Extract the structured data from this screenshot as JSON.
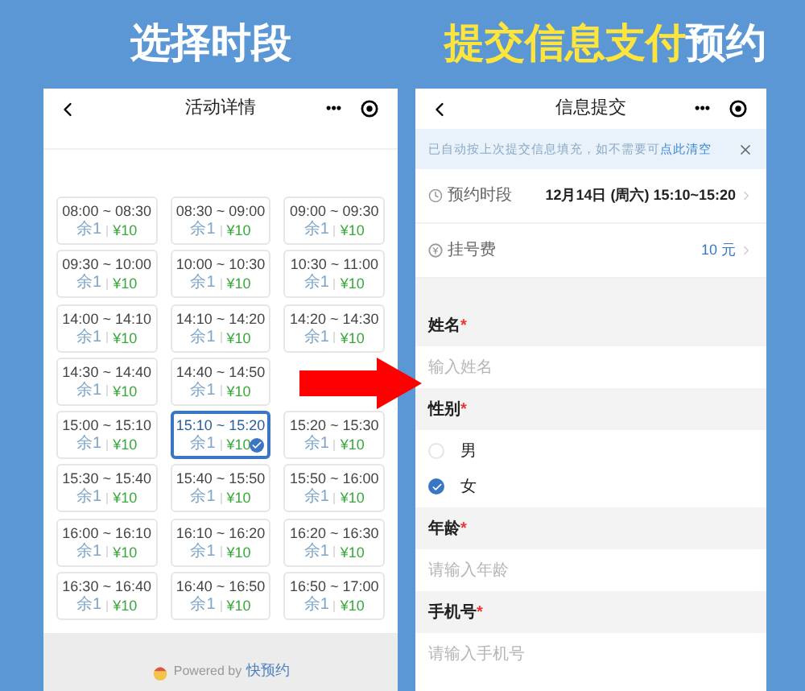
{
  "left_heading": "选择时段",
  "right_heading": {
    "highlighted": "提交信息支付",
    "plain": "预约"
  },
  "left_screen": {
    "title": "活动详情",
    "capsule_dots": "•••",
    "slots": [
      {
        "kind": "slot",
        "time": "08:00 ~ 08:30",
        "remaining": "余1",
        "price": "¥10",
        "selected": false
      },
      {
        "kind": "slot",
        "time": "08:30 ~ 09:00",
        "remaining": "余1",
        "price": "¥10",
        "selected": false
      },
      {
        "kind": "slot",
        "time": "09:00 ~ 09:30",
        "remaining": "余1",
        "price": "¥10",
        "selected": false
      },
      {
        "kind": "slot",
        "time": "09:30 ~ 10:00",
        "remaining": "余1",
        "price": "¥10",
        "selected": false
      },
      {
        "kind": "slot",
        "time": "10:00 ~ 10:30",
        "remaining": "余1",
        "price": "¥10",
        "selected": false
      },
      {
        "kind": "slot",
        "time": "10:30 ~ 11:00",
        "remaining": "余1",
        "price": "¥10",
        "selected": false
      },
      {
        "kind": "slot",
        "time": "14:00 ~ 14:10",
        "remaining": "余1",
        "price": "¥10",
        "selected": false
      },
      {
        "kind": "slot",
        "time": "14:10 ~ 14:20",
        "remaining": "余1",
        "price": "¥10",
        "selected": false
      },
      {
        "kind": "slot",
        "time": "14:20 ~ 14:30",
        "remaining": "余1",
        "price": "¥10",
        "selected": false
      },
      {
        "kind": "slot",
        "time": "14:30 ~ 14:40",
        "remaining": "余1",
        "price": "¥10",
        "selected": false
      },
      {
        "kind": "slot",
        "time": "14:40 ~ 14:50",
        "remaining": "余1",
        "price": "¥10",
        "selected": false
      },
      {
        "kind": "covered"
      },
      {
        "kind": "slot",
        "time": "15:00 ~ 15:10",
        "remaining": "余1",
        "price": "¥10",
        "selected": false
      },
      {
        "kind": "slot",
        "time": "15:10 ~ 15:20",
        "remaining": "余1",
        "price": "¥10",
        "selected": true
      },
      {
        "kind": "slot",
        "time": "15:20 ~ 15:30",
        "remaining": "余1",
        "price": "¥10",
        "selected": false
      },
      {
        "kind": "slot",
        "time": "15:30 ~ 15:40",
        "remaining": "余1",
        "price": "¥10",
        "selected": false
      },
      {
        "kind": "slot",
        "time": "15:40 ~ 15:50",
        "remaining": "余1",
        "price": "¥10",
        "selected": false
      },
      {
        "kind": "slot",
        "time": "15:50 ~ 16:00",
        "remaining": "余1",
        "price": "¥10",
        "selected": false
      },
      {
        "kind": "slot",
        "time": "16:00 ~ 16:10",
        "remaining": "余1",
        "price": "¥10",
        "selected": false
      },
      {
        "kind": "slot",
        "time": "16:10 ~ 16:20",
        "remaining": "余1",
        "price": "¥10",
        "selected": false
      },
      {
        "kind": "slot",
        "time": "16:20 ~ 16:30",
        "remaining": "余1",
        "price": "¥10",
        "selected": false
      },
      {
        "kind": "slot",
        "time": "16:30 ~ 16:40",
        "remaining": "余1",
        "price": "¥10",
        "selected": false
      },
      {
        "kind": "slot",
        "time": "16:40 ~ 16:50",
        "remaining": "余1",
        "price": "¥10",
        "selected": false
      },
      {
        "kind": "slot",
        "time": "16:50 ~ 17:00",
        "remaining": "余1",
        "price": "¥10",
        "selected": false
      }
    ],
    "footer": {
      "prefix": "Powered by",
      "brand": "快预约"
    }
  },
  "right_screen": {
    "title": "信息提交",
    "capsule_dots": "•••",
    "notice": {
      "text": "已自动按上次提交信息填充，如不需要可",
      "link": "点此清空"
    },
    "info_rows": [
      {
        "kind": "clock",
        "label": "预约时段",
        "value": "12月14日 (周六) 15:10~15:20"
      },
      {
        "kind": "fee",
        "label": "挂号费",
        "value": "10 元"
      }
    ],
    "fields": [
      {
        "kind": "text",
        "label": "姓名",
        "required": "*",
        "placeholder": "输入姓名"
      },
      {
        "kind": "radio",
        "label": "性别",
        "required": "*",
        "options": [
          {
            "label": "男",
            "selected": false
          },
          {
            "label": "女",
            "selected": true
          }
        ]
      },
      {
        "kind": "text",
        "label": "年龄",
        "required": "*",
        "placeholder": "请输入年龄"
      },
      {
        "kind": "text",
        "label": "手机号",
        "required": "*",
        "placeholder": "请输入手机号"
      }
    ]
  }
}
